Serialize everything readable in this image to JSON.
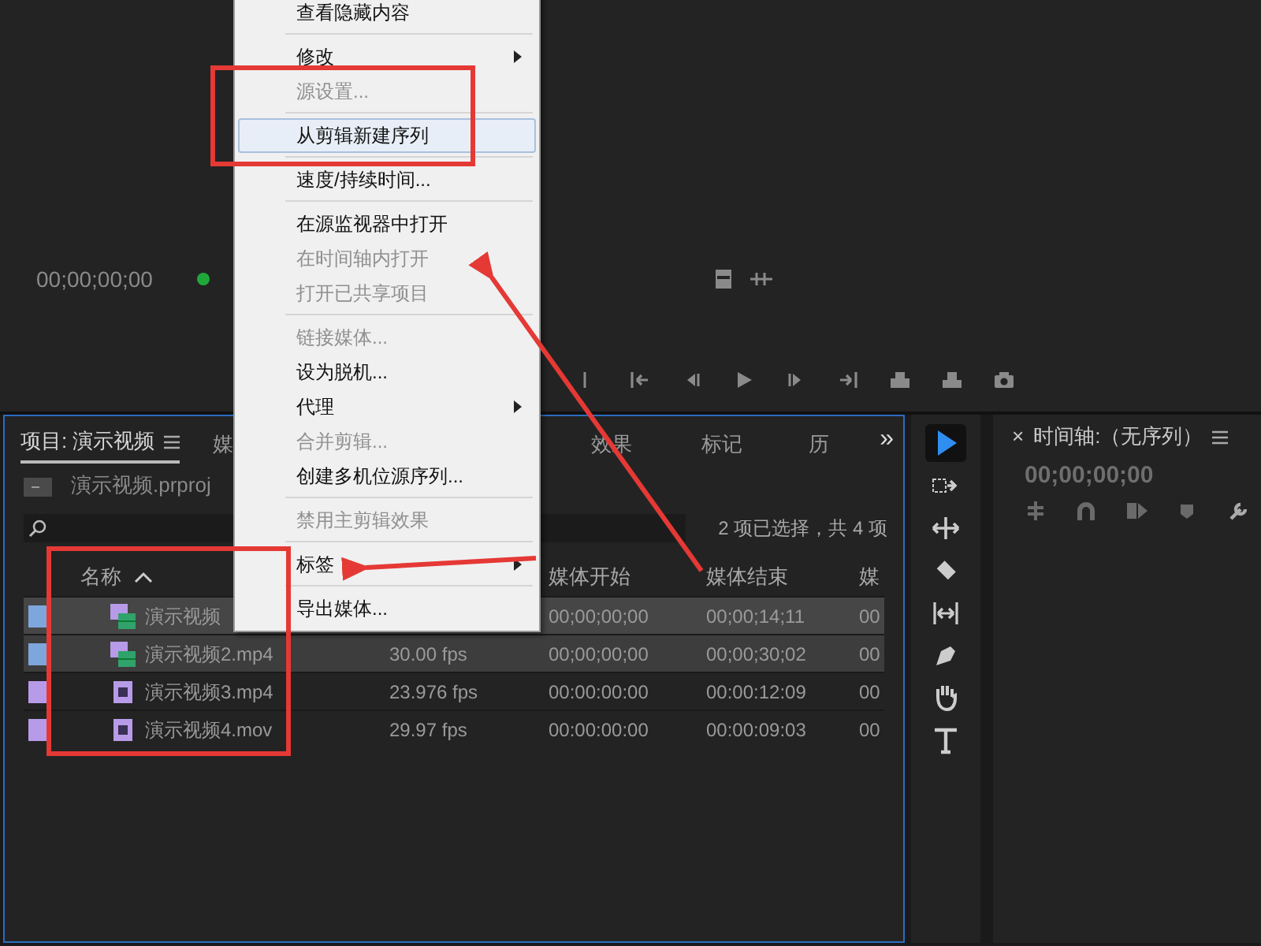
{
  "source_monitor": {
    "timecode": "00;00;00;00",
    "playhead_active": true
  },
  "context_menu": {
    "items": [
      {
        "kind": "item",
        "label": "查看隐藏内容",
        "disabled": false,
        "highlighted": false,
        "submenu": false
      },
      {
        "kind": "separator"
      },
      {
        "kind": "item",
        "label": "修改",
        "disabled": false,
        "highlighted": false,
        "submenu": true
      },
      {
        "kind": "item",
        "label": "源设置...",
        "disabled": true,
        "highlighted": false,
        "submenu": false
      },
      {
        "kind": "separator"
      },
      {
        "kind": "item",
        "label": "从剪辑新建序列",
        "disabled": false,
        "highlighted": true,
        "submenu": false
      },
      {
        "kind": "separator"
      },
      {
        "kind": "item",
        "label": "速度/持续时间...",
        "disabled": false,
        "highlighted": false,
        "submenu": false
      },
      {
        "kind": "separator"
      },
      {
        "kind": "item",
        "label": "在源监视器中打开",
        "disabled": false,
        "highlighted": false,
        "submenu": false
      },
      {
        "kind": "item",
        "label": "在时间轴内打开",
        "disabled": true,
        "highlighted": false,
        "submenu": false
      },
      {
        "kind": "item",
        "label": "打开已共享项目",
        "disabled": true,
        "highlighted": false,
        "submenu": false
      },
      {
        "kind": "separator"
      },
      {
        "kind": "item",
        "label": "链接媒体...",
        "disabled": true,
        "highlighted": false,
        "submenu": false
      },
      {
        "kind": "item",
        "label": "设为脱机...",
        "disabled": false,
        "highlighted": false,
        "submenu": false
      },
      {
        "kind": "item",
        "label": "代理",
        "disabled": false,
        "highlighted": false,
        "submenu": true
      },
      {
        "kind": "item",
        "label": "合并剪辑...",
        "disabled": true,
        "highlighted": false,
        "submenu": false
      },
      {
        "kind": "item",
        "label": "创建多机位源序列...",
        "disabled": false,
        "highlighted": false,
        "submenu": false
      },
      {
        "kind": "separator"
      },
      {
        "kind": "item",
        "label": "禁用主剪辑效果",
        "disabled": true,
        "highlighted": false,
        "submenu": false
      },
      {
        "kind": "separator"
      },
      {
        "kind": "item",
        "label": "标签",
        "disabled": false,
        "highlighted": false,
        "submenu": true
      },
      {
        "kind": "separator"
      },
      {
        "kind": "item",
        "label": "导出媒体...",
        "disabled": false,
        "highlighted": false,
        "submenu": false
      }
    ]
  },
  "project_panel": {
    "tabs": [
      {
        "label": "项目: 演示视频",
        "selected": true,
        "menu": true
      },
      {
        "label": "媒",
        "selected": false,
        "menu": false
      },
      {
        "label": "效果",
        "selected": false,
        "menu": false
      },
      {
        "label": "标记",
        "selected": false,
        "menu": false
      },
      {
        "label": "历",
        "selected": false,
        "menu": false
      }
    ],
    "more_tabs": "»",
    "project_file": "演示视频.prproj",
    "selection_summary": "2 项已选择，共 4 项",
    "columns": [
      {
        "label": "名称",
        "sorted": true
      },
      {
        "label": "媒体开始",
        "sorted": false
      },
      {
        "label": "媒体结束",
        "sorted": false
      },
      {
        "label": "媒",
        "sorted": false
      }
    ],
    "rows": [
      {
        "selected": true,
        "color": "#7fa6dc",
        "kind": "sequence",
        "name": "演示视频",
        "media_start": "00;00;00;00",
        "media_end": "00;00;14;11",
        "column_5": "00"
      },
      {
        "selected": true,
        "color": "#7fa6dc",
        "kind": "sequence",
        "name": "演示视频2.mp4",
        "frame_rate": "30.00 fps",
        "media_start": "00;00;00;00",
        "media_end": "00;00;30;02",
        "column_5": "00"
      },
      {
        "selected": false,
        "color": "#b79be8",
        "kind": "clip",
        "name": "演示视频3.mp4",
        "frame_rate": "23.976 fps",
        "media_start": "00:00:00:00",
        "media_end": "00:00:12:09",
        "column_5": "00"
      },
      {
        "selected": false,
        "color": "#b79be8",
        "kind": "clip",
        "name": "演示视频4.mov",
        "frame_rate": "29.97 fps",
        "media_start": "00:00:00:00",
        "media_end": "00:00:09:03",
        "column_5": "00"
      }
    ]
  },
  "tools": [
    {
      "kind": "select",
      "selected": true
    },
    {
      "kind": "track",
      "selected": false
    },
    {
      "kind": "ripple",
      "selected": false
    },
    {
      "kind": "razor",
      "selected": false
    },
    {
      "kind": "slip",
      "selected": false
    },
    {
      "kind": "pen",
      "selected": false
    },
    {
      "kind": "hand",
      "selected": false
    },
    {
      "kind": "type",
      "selected": false
    }
  ],
  "timeline": {
    "close": "×",
    "title": "时间轴:（无序列）",
    "timecode": "00;00;00;00"
  }
}
